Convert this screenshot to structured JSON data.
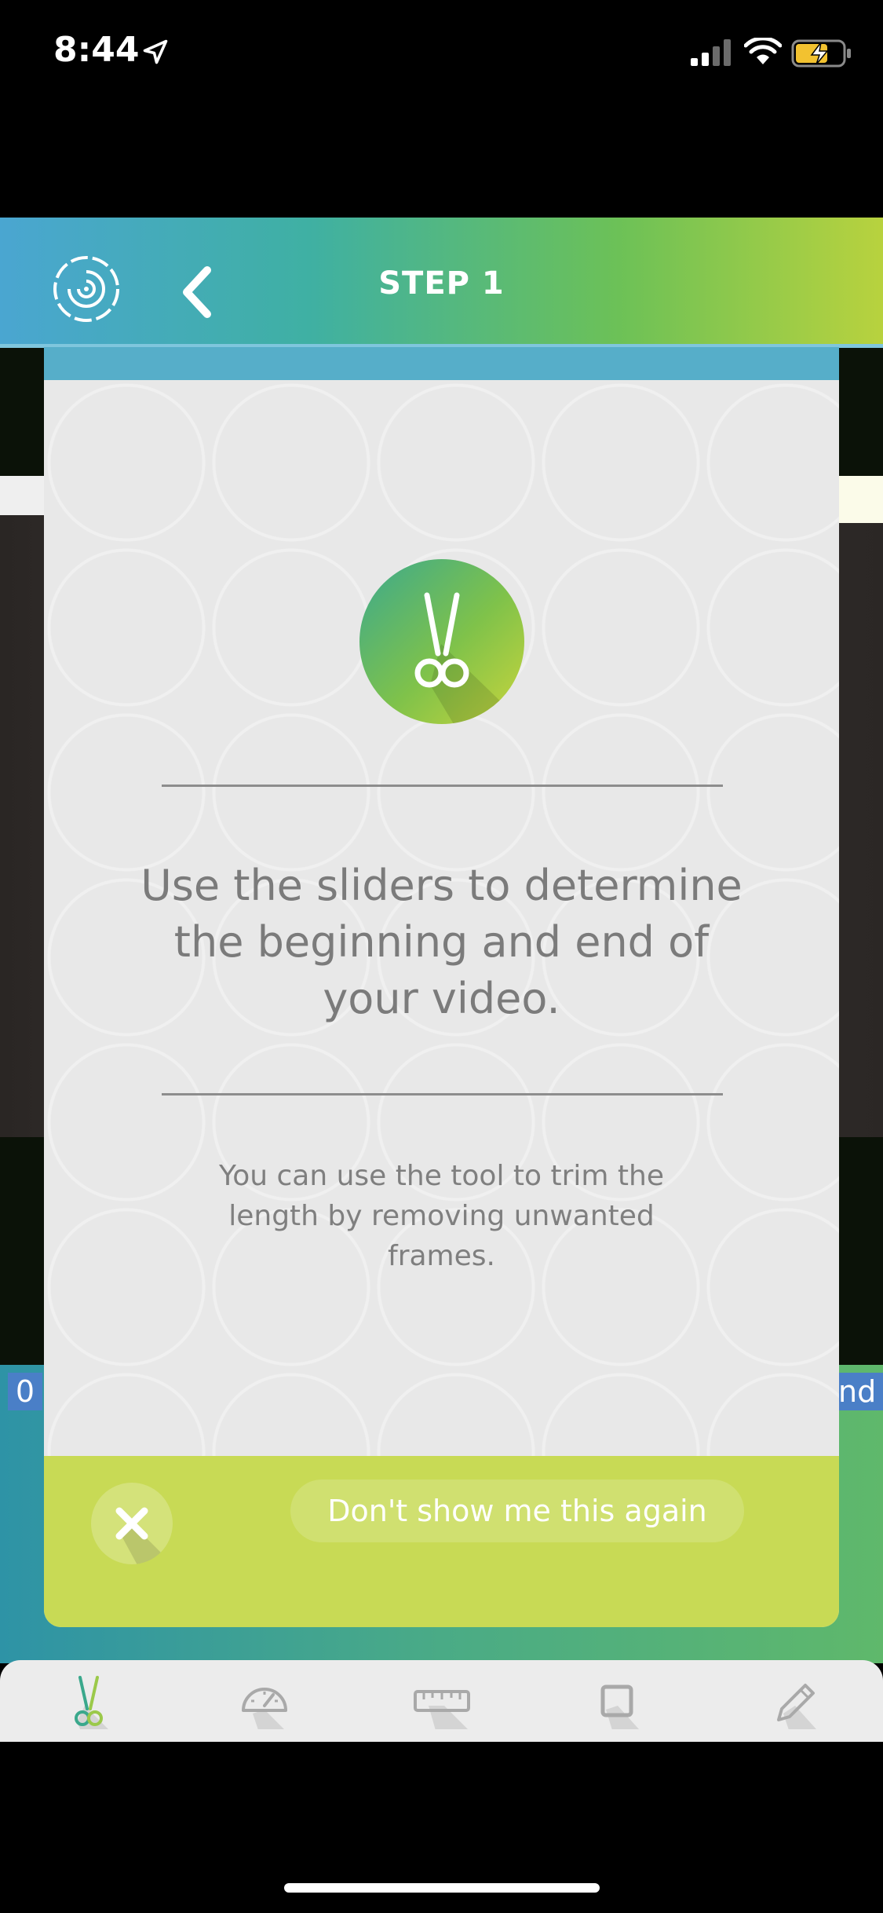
{
  "status_bar": {
    "time": "8:44",
    "icons": [
      "location-arrow-icon",
      "cellular-signal-icon",
      "wifi-icon",
      "battery-charging-icon"
    ]
  },
  "header": {
    "title": "STEP 1",
    "icons": [
      "app-logo-icon",
      "back-chevron-icon"
    ]
  },
  "timeline": {
    "left_label": "0",
    "right_label": "nd"
  },
  "card": {
    "icon": "scissors-icon",
    "headline": "Use the sliders to determine the beginning and end of your video.",
    "description": "You can use the tool to trim the length by removing unwanted frames.",
    "dismiss_label": "Don't show me this again",
    "close_icon": "close-icon"
  },
  "toolbar": {
    "tools": [
      {
        "name": "trim-tool",
        "icon": "scissors-icon",
        "active": true
      },
      {
        "name": "speed-tool",
        "icon": "speedometer-icon",
        "active": false
      },
      {
        "name": "measure-tool",
        "icon": "ruler-icon",
        "active": false
      },
      {
        "name": "crop-tool",
        "icon": "square-icon",
        "active": false
      },
      {
        "name": "draw-tool",
        "icon": "pencil-icon",
        "active": false
      }
    ]
  },
  "colors": {
    "header_gradient_start": "#4aa6d1",
    "header_gradient_end": "#b8d23e",
    "card_footer": "#c8da55",
    "card_topbar": "#56aec9",
    "card_body": "#e8e8e8"
  }
}
